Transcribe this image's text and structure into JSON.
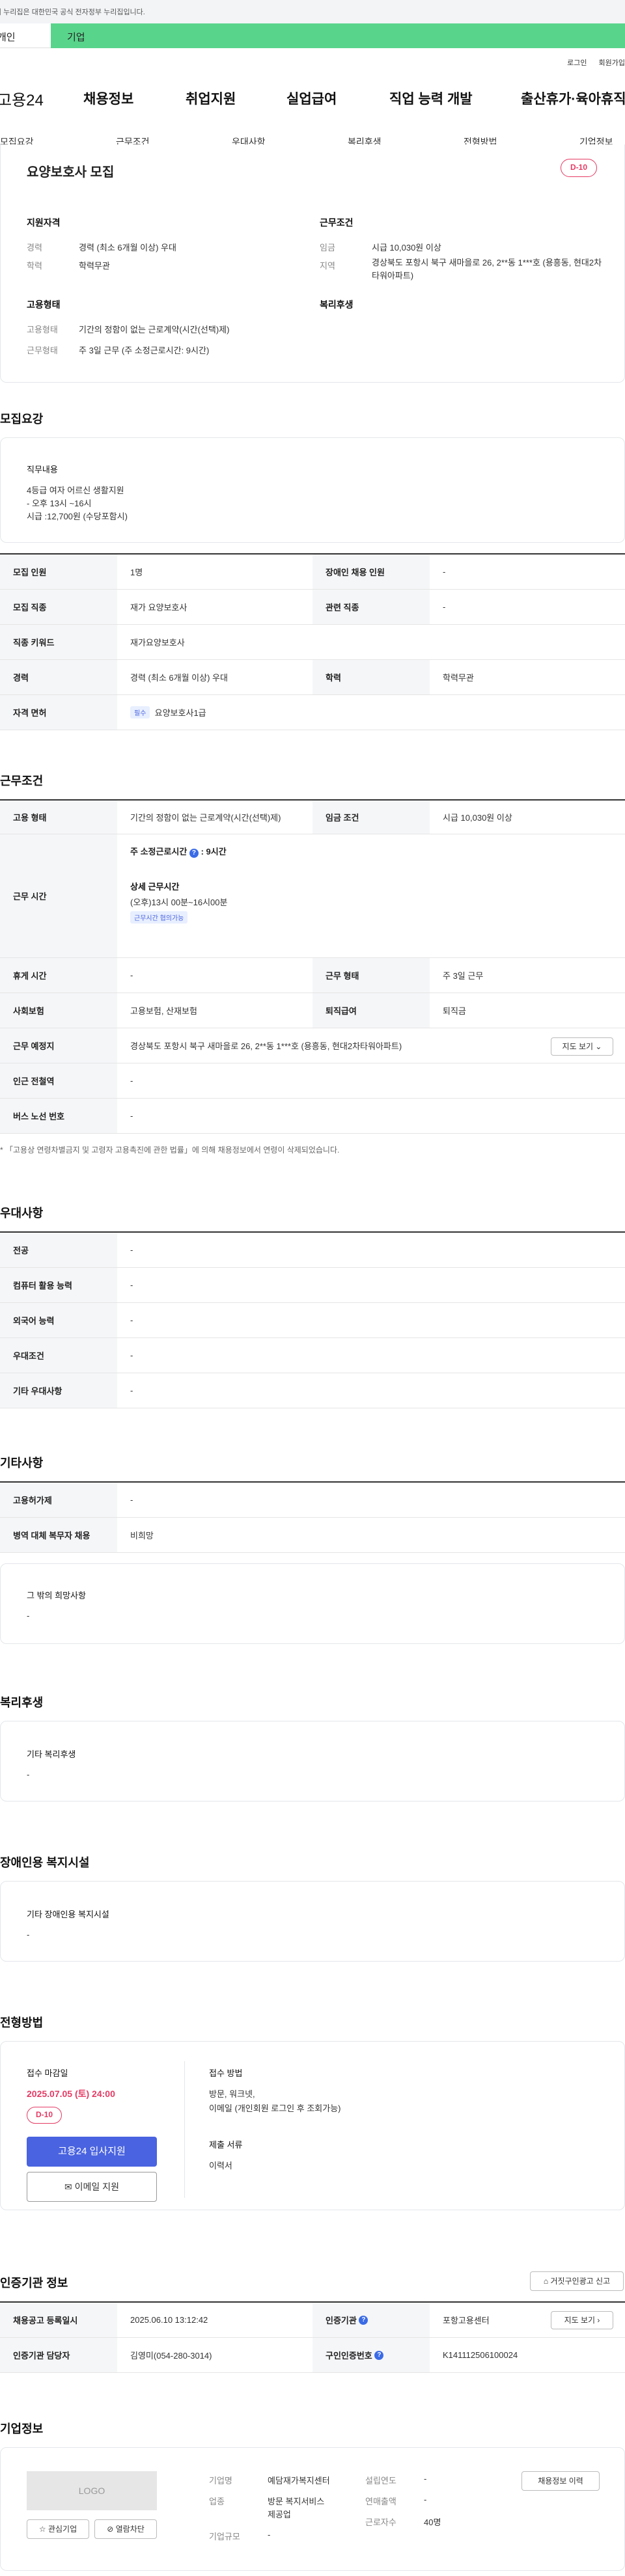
{
  "gov_notice": "이 누리집은 대한민국 공식 전자정부 누리집입니다.",
  "usertype": {
    "a": "개인",
    "b": "기업"
  },
  "util": {
    "login": "로그인",
    "join": "회원가입"
  },
  "gnb": {
    "logo": "고용24",
    "items": [
      "채용정보",
      "취업지원",
      "실업급여",
      "직업 능력 개발",
      "출산휴가·육아휴직"
    ]
  },
  "tabs": [
    "모집요강",
    "근무조건",
    "우대사항",
    "복리후생",
    "전형방법",
    "기업정보"
  ],
  "summary": {
    "title": "요양보호사 모집",
    "dday": "D-10",
    "qual_h": "지원자격",
    "career_l": "경력",
    "career_v": "경력 (최소 6개월 이상) 우대",
    "edu_l": "학력",
    "edu_v": "학력무관",
    "work_h": "근무조건",
    "wage_l": "임금",
    "wage_v": "시급 10,030원 이상",
    "loc_l": "지역",
    "loc_v": "경상북도 포항시 북구 새마을로 26, 2**동 1***호 (용흥동, 현대2차타워아파트)",
    "emp_h": "고용형태",
    "emptype_l": "고용형태",
    "emptype_v": "기간의 정함이 없는 근로계약(시간(선택)제)",
    "workhours_l": "근무형태",
    "workhours_v": "주 3일 근무 (주 소정근로시간: 9시간)",
    "welfare_h": "복리후생"
  },
  "recruit": {
    "title": "모집요강",
    "duty_h": "직무내용",
    "duty_lines": [
      "4등급 여자 어르신 생활지원",
      "- 오후 13시 ~16시",
      "시급 :12,700원 (수당포함시)"
    ],
    "rows": [
      {
        "l1": "모집 인원",
        "v1": "1명",
        "l2": "장애인 채용 인원",
        "v2": "-"
      },
      {
        "l1": "모집 직종",
        "v1": "재가 요양보호사",
        "l2": "관련 직종",
        "v2": "-"
      },
      {
        "l1": "직종 키워드",
        "v1": "재가요양보호사"
      },
      {
        "l1": "경력",
        "v1": "경력 (최소 6개월 이상) 우대",
        "l2": "학력",
        "v2": "학력무관"
      },
      {
        "l1": "자격 면허",
        "chip": "필수",
        "v1": "요양보호사1급"
      }
    ]
  },
  "cond": {
    "title": "근무조건",
    "emptype_l": "고용 형태",
    "emptype_v": "기간의 정함이 없는 근로계약(시간(선택)제)",
    "wage_l": "임금 조건",
    "wage_v": "시급 10,030원 이상",
    "time_l": "근무 시간",
    "weekly": "주 소정근로시간",
    "weekly_v": "9시간",
    "detail_h": "상세 근무시간",
    "detail_v": "(오후)13시 00분~16시00분",
    "chip": "근무시간 협의가능",
    "rest_l": "휴게 시간",
    "rest_v": "-",
    "shape_l": "근무 형태",
    "shape_v": "주 3일 근무",
    "ins_l": "사회보험",
    "ins_v": "고용보험, 산재보험",
    "sev_l": "퇴직급여",
    "sev_v": "퇴직금",
    "place_l": "근무 예정지",
    "place_v": "경상북도 포항시 북구 새마을로 26, 2**동 1***호 (용흥동, 현대2차타워아파트)",
    "map_btn": "지도 보기",
    "sub_l": "인근 전철역",
    "sub_v": "-",
    "bus_l": "버스 노선 번호",
    "bus_v": "-",
    "note": "* 「고용상 연령차별금지 및 고령자 고용촉진에 관한 법률」에 의해 채용정보에서 연령이 삭제되었습니다."
  },
  "pref": {
    "title": "우대사항",
    "rows": [
      [
        "전공",
        "-"
      ],
      [
        "컴퓨터 활용 능력",
        "-"
      ],
      [
        "외국어 능력",
        "-"
      ],
      [
        "우대조건",
        "-"
      ],
      [
        "기타 우대사항",
        "-"
      ]
    ]
  },
  "etc": {
    "title": "기타사항",
    "rows": [
      [
        "고용허가제",
        "-"
      ],
      [
        "병역 대체 복무자 채용",
        "비희망"
      ]
    ],
    "other_h": "그 밖의 희망사항",
    "other_v": "-"
  },
  "welfare": {
    "title": "복리후생",
    "h": "기타 복리후생",
    "v": "-"
  },
  "disab": {
    "title": "장애인용 복지시설",
    "h": "기타 장애인용 복지시설",
    "v": "-"
  },
  "screen": {
    "title": "전형방법",
    "deadline_h": "접수 마감일",
    "deadline_v": "2025.07.05 (토) 24:00",
    "dday": "D-10",
    "apply_btn": "고용24 입사지원",
    "email_btn": "이메일 지원",
    "method_h": "접수 방법",
    "method_v1": "방문, 워크넷,",
    "method_v2": "이메일 (개인회원 로그인 후 조회가능)",
    "docs_h": "제출 서류",
    "docs_v": "이력서"
  },
  "agency": {
    "title": "인증기관 정보",
    "report_btn": "거짓구인광고 신고",
    "reg_l": "채용공고 등록일시",
    "reg_v": "2025.06.10 13:12:42",
    "org_l": "인증기관",
    "org_v": "포항고용센터",
    "map_btn": "지도 보기",
    "mgr_l": "인증기관 담당자",
    "mgr_v": "김영미(054-280-3014)",
    "no_l": "구인인증번호",
    "no_v": "K141112506100024"
  },
  "company": {
    "title": "기업정보",
    "logo": "LOGO",
    "fav_btn": "관심기업",
    "block_btn": "열람차단",
    "hist_btn": "채용정보 이력",
    "name_l": "기업명",
    "name_v": "예담재가복지센터",
    "ind_l": "업종",
    "ind_v1": "방문 복지서비스",
    "ind_v2": "제공업",
    "size_l": "기업규모",
    "size_v": "-",
    "year_l": "설립연도",
    "year_v": "-",
    "sales_l": "연매출액",
    "sales_v": "-",
    "emp_l": "근로자수",
    "emp_v": "40명"
  }
}
